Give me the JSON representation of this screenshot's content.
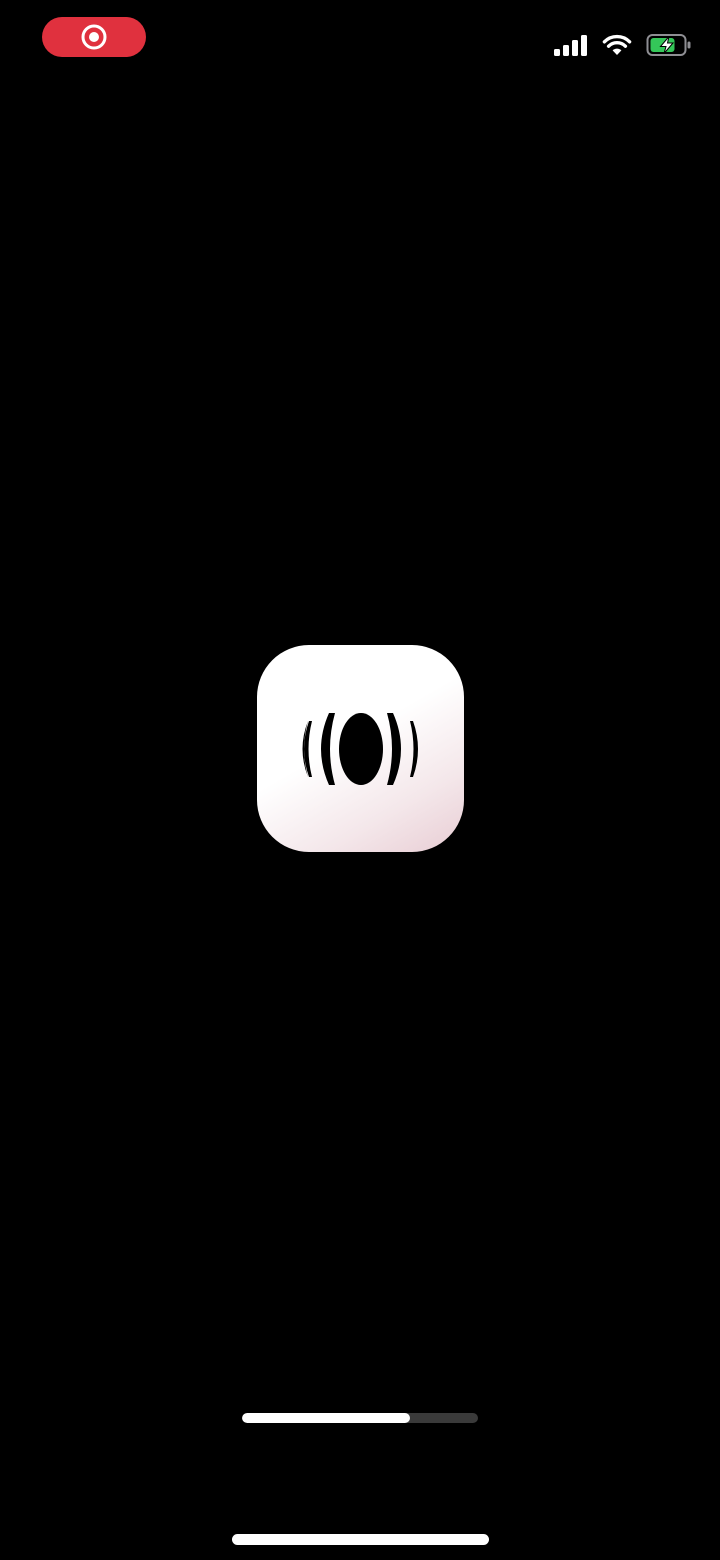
{
  "status_bar": {
    "recording_indicator_icon": "screen-recording-icon",
    "recording_color": "#E0313E",
    "signal_icon": "cellular-signal-icon",
    "wifi_icon": "wifi-icon",
    "battery_icon": "battery-charging-icon",
    "battery_color": "#34C759"
  },
  "splash": {
    "app_icon": "app-logo-icon",
    "background_color": "#000000"
  },
  "loading": {
    "progress": 0.71
  }
}
